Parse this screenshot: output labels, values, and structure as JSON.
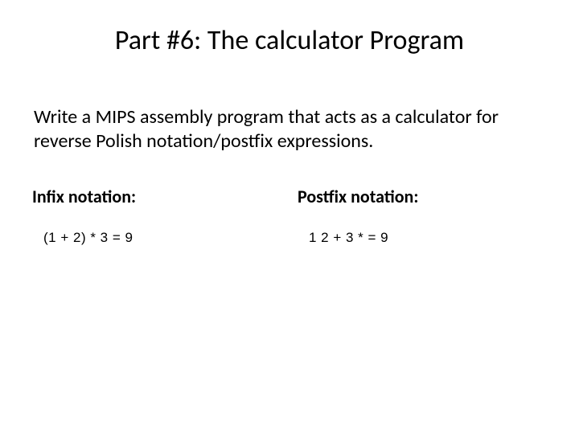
{
  "title": {
    "prefix": "Part #6: The ",
    "emph": "calculator",
    "suffix": " Program"
  },
  "body": "Write a MIPS assembly program that acts as a calculator for reverse Polish notation/postfix expressions.",
  "columns": {
    "left": {
      "heading": "Infix notation:",
      "example": "(1 + 2) * 3 = 9"
    },
    "right": {
      "heading": "Postfix notation:",
      "example": "1 2 + 3 *  = 9"
    }
  }
}
